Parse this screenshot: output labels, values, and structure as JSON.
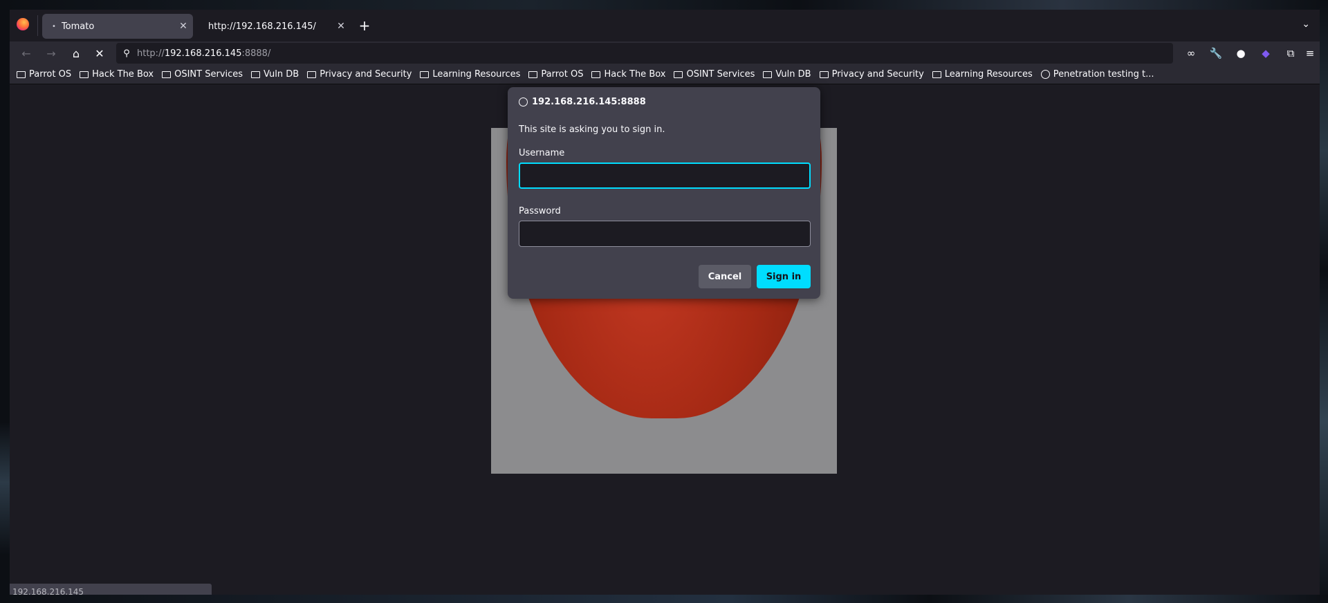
{
  "tabs": [
    {
      "title": "Tomato",
      "active": true,
      "loading_indicator": "•"
    },
    {
      "title": "http://192.168.216.145/",
      "active": false
    }
  ],
  "navbar": {
    "url_prefix": "http://",
    "url_host": "192.168.216.145",
    "url_suffix": ":8888/"
  },
  "bookmarks": [
    {
      "label": "Parrot OS",
      "icon": "folder-icon"
    },
    {
      "label": "Hack The Box",
      "icon": "folder-icon"
    },
    {
      "label": "OSINT Services",
      "icon": "folder-icon"
    },
    {
      "label": "Vuln DB",
      "icon": "folder-icon"
    },
    {
      "label": "Privacy and Security",
      "icon": "folder-icon"
    },
    {
      "label": "Learning Resources",
      "icon": "folder-icon"
    },
    {
      "label": "Parrot OS",
      "icon": "folder-icon"
    },
    {
      "label": "Hack The Box",
      "icon": "folder-icon"
    },
    {
      "label": "OSINT Services",
      "icon": "folder-icon"
    },
    {
      "label": "Vuln DB",
      "icon": "folder-icon"
    },
    {
      "label": "Privacy and Security",
      "icon": "folder-icon"
    },
    {
      "label": "Learning Resources",
      "icon": "folder-icon"
    },
    {
      "label": "Penetration testing t...",
      "icon": "globe-icon"
    }
  ],
  "dialog": {
    "host": "192.168.216.145:8888",
    "message": "This site is asking you to sign in.",
    "username_label": "Username",
    "username_value": "",
    "password_label": "Password",
    "password_value": "",
    "cancel_label": "Cancel",
    "signin_label": "Sign in"
  },
  "status_text": "192.168.216.145",
  "colors": {
    "accent": "#00ddff",
    "dialog_bg": "#42414d",
    "chrome_bg": "#2b2a33"
  }
}
